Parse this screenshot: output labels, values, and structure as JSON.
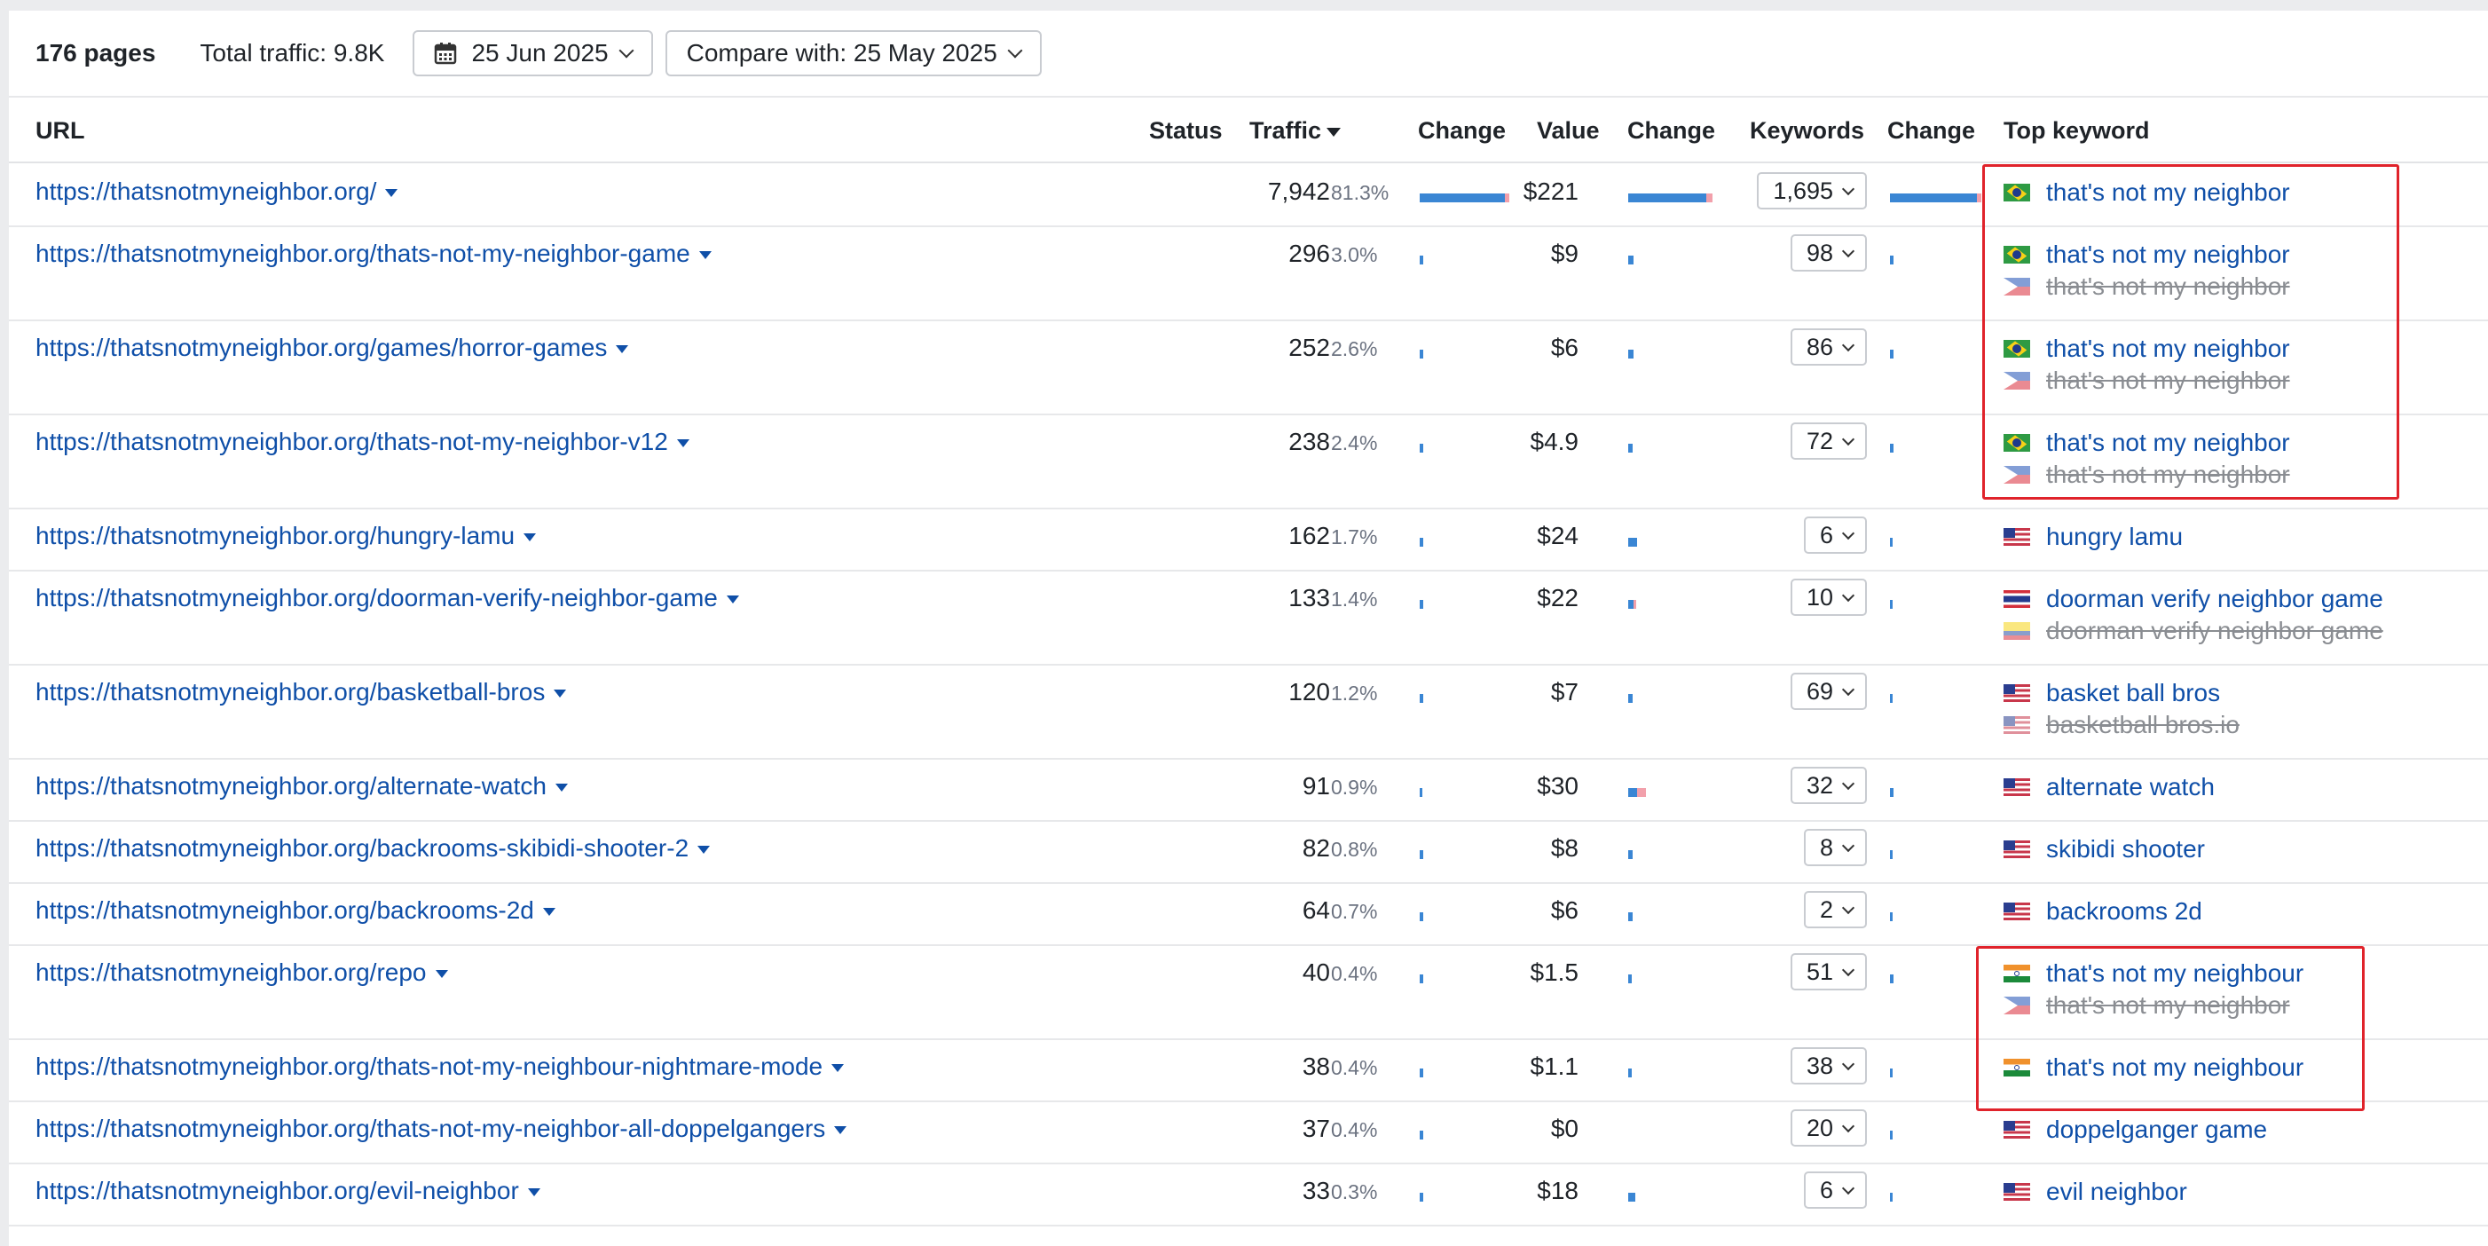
{
  "toolbar": {
    "pages_count": "176 pages",
    "total_traffic": "Total traffic: 9.8K",
    "date": "25 Jun 2025",
    "compare": "Compare with: 25 May 2025"
  },
  "headers": {
    "url": "URL",
    "status": "Status",
    "traffic": "Traffic",
    "change1": "Change",
    "value": "Value",
    "change2": "Change",
    "keywords": "Keywords",
    "change3": "Change",
    "top_keyword": "Top keyword"
  },
  "colors": {
    "link": "#0f4fa8",
    "bar": "#3a86d4",
    "bar_negative": "#f2a0ab",
    "annotation": "#e0232b"
  },
  "rows": [
    {
      "url": "https://thatsnotmyneighbor.org/",
      "traffic": "7,942",
      "pct": "81.3%",
      "value": "$221",
      "keywords": "1,695",
      "top_keywords": [
        {
          "text": "that's not my neighbor",
          "flag": "brazil-flag-icon",
          "lost": false
        }
      ]
    },
    {
      "url": "https://thatsnotmyneighbor.org/thats-not-my-neighbor-game",
      "traffic": "296",
      "pct": "3.0%",
      "value": "$9",
      "keywords": "98",
      "top_keywords": [
        {
          "text": "that's not my neighbor",
          "flag": "brazil-flag-icon",
          "lost": false
        },
        {
          "text": "that's not my neighbor",
          "flag": "philippines-flag-icon",
          "lost": true
        }
      ]
    },
    {
      "url": "https://thatsnotmyneighbor.org/games/horror-games",
      "traffic": "252",
      "pct": "2.6%",
      "value": "$6",
      "keywords": "86",
      "top_keywords": [
        {
          "text": "that's not my neighbor",
          "flag": "brazil-flag-icon",
          "lost": false
        },
        {
          "text": "that's not my neighbor",
          "flag": "philippines-flag-icon",
          "lost": true
        }
      ]
    },
    {
      "url": "https://thatsnotmyneighbor.org/thats-not-my-neighbor-v12",
      "traffic": "238",
      "pct": "2.4%",
      "value": "$4.9",
      "keywords": "72",
      "top_keywords": [
        {
          "text": "that's not my neighbor",
          "flag": "brazil-flag-icon",
          "lost": false
        },
        {
          "text": "that's not my neighbor",
          "flag": "philippines-flag-icon",
          "lost": true
        }
      ]
    },
    {
      "url": "https://thatsnotmyneighbor.org/hungry-lamu",
      "traffic": "162",
      "pct": "1.7%",
      "value": "$24",
      "keywords": "6",
      "top_keywords": [
        {
          "text": "hungry lamu",
          "flag": "us-flag-icon",
          "lost": false
        }
      ]
    },
    {
      "url": "https://thatsnotmyneighbor.org/doorman-verify-neighbor-game",
      "traffic": "133",
      "pct": "1.4%",
      "value": "$22",
      "keywords": "10",
      "top_keywords": [
        {
          "text": "doorman verify neighbor game",
          "flag": "thailand-flag-icon",
          "lost": false
        },
        {
          "text": "doorman verify neighbor game",
          "flag": "colombia-flag-icon",
          "lost": true
        }
      ]
    },
    {
      "url": "https://thatsnotmyneighbor.org/basketball-bros",
      "traffic": "120",
      "pct": "1.2%",
      "value": "$7",
      "keywords": "69",
      "top_keywords": [
        {
          "text": "basket ball bros",
          "flag": "us-flag-icon",
          "lost": false
        },
        {
          "text": "basketball bros.io",
          "flag": "us-flag-icon",
          "lost": true
        }
      ]
    },
    {
      "url": "https://thatsnotmyneighbor.org/alternate-watch",
      "traffic": "91",
      "pct": "0.9%",
      "value": "$30",
      "keywords": "32",
      "top_keywords": [
        {
          "text": "alternate watch",
          "flag": "us-flag-icon",
          "lost": false
        }
      ]
    },
    {
      "url": "https://thatsnotmyneighbor.org/backrooms-skibidi-shooter-2",
      "traffic": "82",
      "pct": "0.8%",
      "value": "$8",
      "keywords": "8",
      "top_keywords": [
        {
          "text": "skibidi shooter",
          "flag": "us-flag-icon",
          "lost": false
        }
      ]
    },
    {
      "url": "https://thatsnotmyneighbor.org/backrooms-2d",
      "traffic": "64",
      "pct": "0.7%",
      "value": "$6",
      "keywords": "2",
      "top_keywords": [
        {
          "text": "backrooms 2d",
          "flag": "us-flag-icon",
          "lost": false
        }
      ]
    },
    {
      "url": "https://thatsnotmyneighbor.org/repo",
      "traffic": "40",
      "pct": "0.4%",
      "value": "$1.5",
      "keywords": "51",
      "top_keywords": [
        {
          "text": "that's not my neighbour",
          "flag": "india-flag-icon",
          "lost": false
        },
        {
          "text": "that's not my neighbor",
          "flag": "philippines-flag-icon",
          "lost": true
        }
      ]
    },
    {
      "url": "https://thatsnotmyneighbor.org/thats-not-my-neighbour-nightmare-mode",
      "traffic": "38",
      "pct": "0.4%",
      "value": "$1.1",
      "keywords": "38",
      "top_keywords": [
        {
          "text": "that's not my neighbour",
          "flag": "india-flag-icon",
          "lost": false
        }
      ]
    },
    {
      "url": "https://thatsnotmyneighbor.org/thats-not-my-neighbor-all-doppelgangers",
      "traffic": "37",
      "pct": "0.4%",
      "value": "$0",
      "keywords": "20",
      "top_keywords": [
        {
          "text": "doppelganger game",
          "flag": "us-flag-icon",
          "lost": false
        }
      ]
    },
    {
      "url": "https://thatsnotmyneighbor.org/evil-neighbor",
      "traffic": "33",
      "pct": "0.3%",
      "value": "$18",
      "keywords": "6",
      "top_keywords": [
        {
          "text": "evil neighbor",
          "flag": "us-flag-icon",
          "lost": false
        }
      ]
    }
  ]
}
